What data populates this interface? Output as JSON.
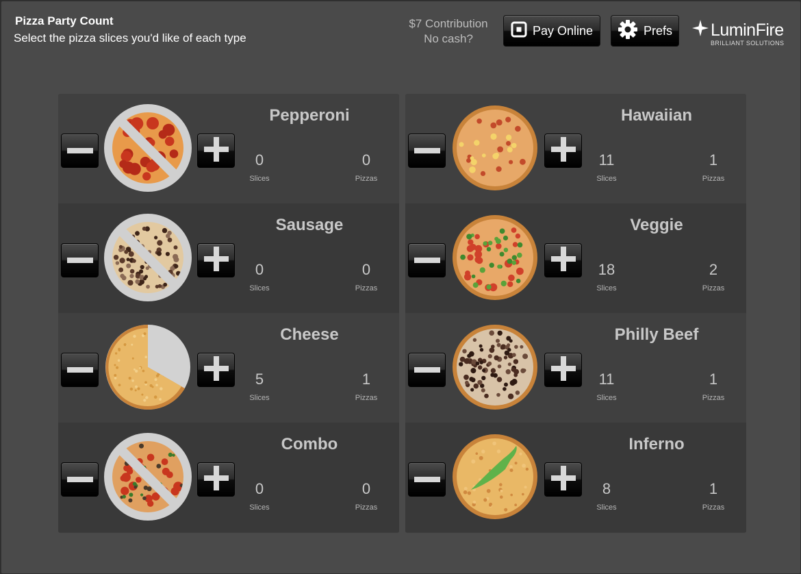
{
  "header": {
    "title": "Pizza Party Count",
    "subtitle": "Select the pizza slices you'd like of each type",
    "contribution_line1": "$7 Contribution",
    "contribution_line2": "No cash?",
    "pay_label": "Pay Online",
    "prefs_label": "Prefs",
    "logo_text": "LuminFire",
    "logo_tagline": "BRILLIANT SOLUTIONS"
  },
  "labels": {
    "slices": "Slices",
    "pizzas": "Pizzas"
  },
  "pizzas": [
    {
      "name": "Pepperoni",
      "slices": "0",
      "pizzas": "0",
      "state": "none",
      "topping": "pepperoni"
    },
    {
      "name": "Sausage",
      "slices": "0",
      "pizzas": "0",
      "state": "none",
      "topping": "sausage"
    },
    {
      "name": "Cheese",
      "slices": "5",
      "pizzas": "1",
      "state": "partial",
      "topping": "cheese"
    },
    {
      "name": "Combo",
      "slices": "0",
      "pizzas": "0",
      "state": "none",
      "topping": "combo"
    },
    {
      "name": "Hawaiian",
      "slices": "11",
      "pizzas": "1",
      "state": "full",
      "topping": "hawaiian"
    },
    {
      "name": "Veggie",
      "slices": "18",
      "pizzas": "2",
      "state": "full",
      "topping": "veggie"
    },
    {
      "name": "Philly Beef",
      "slices": "11",
      "pizzas": "1",
      "state": "full",
      "topping": "beef"
    },
    {
      "name": "Inferno",
      "slices": "8",
      "pizzas": "1",
      "state": "full",
      "topping": "inferno"
    }
  ],
  "colors": {
    "background": "#4a4a4a",
    "panel": "#3c3c3c",
    "text_muted": "#c8c8c8",
    "no_symbol": "#d0d0d0",
    "pepper_green": "#5fb24a"
  }
}
